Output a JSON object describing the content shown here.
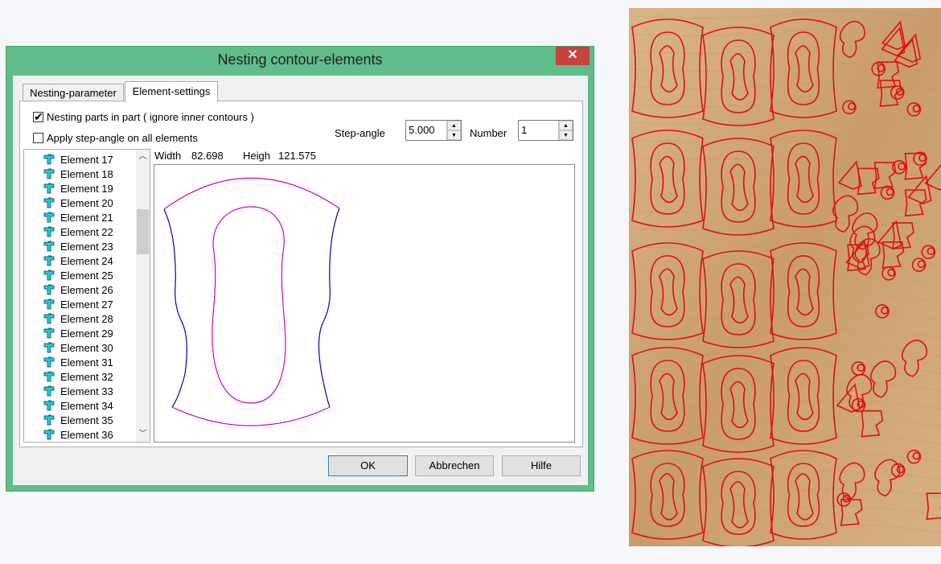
{
  "dialog": {
    "title": "Nesting contour-elements",
    "close_glyph": "✕",
    "tabs": [
      {
        "label": "Nesting-parameter",
        "active": false
      },
      {
        "label": "Element-settings",
        "active": true
      }
    ],
    "nest_parts": {
      "label": "Nesting parts in part ( ignore inner contours )",
      "checked": true,
      "tick": "✔"
    },
    "apply_step": {
      "label": "Apply step-angle on all elements",
      "checked": false
    },
    "step_angle": {
      "label": "Step-angle",
      "value": "5.000"
    },
    "number": {
      "label": "Number",
      "value": "1"
    },
    "spin_up": "▲",
    "spin_down": "▼",
    "width_label": "Width",
    "width_value": "82.698",
    "height_label": "Heigh",
    "height_value": "121.575",
    "scroll_up": "︿",
    "scroll_down": "﹀",
    "elements": [
      "Element 17",
      "Element 18",
      "Element 19",
      "Element 20",
      "Element 21",
      "Element 22",
      "Element 23",
      "Element 24",
      "Element 25",
      "Element 26",
      "Element 27",
      "Element 28",
      "Element 29",
      "Element 30",
      "Element 31",
      "Element 32",
      "Element 33",
      "Element 34",
      "Element 35",
      "Element 36"
    ],
    "buttons": {
      "ok": "OK",
      "cancel": "Abbrechen",
      "help": "Hilfe"
    }
  },
  "colors": {
    "window_frame": "#5ebd88",
    "close_button": "#c7423b",
    "outer_contour": "#d000d0",
    "side_contour": "#0000c0",
    "nest_cut": "#e01010",
    "wood": "#cfa67a"
  },
  "icons": {
    "element": "element-node-icon"
  }
}
